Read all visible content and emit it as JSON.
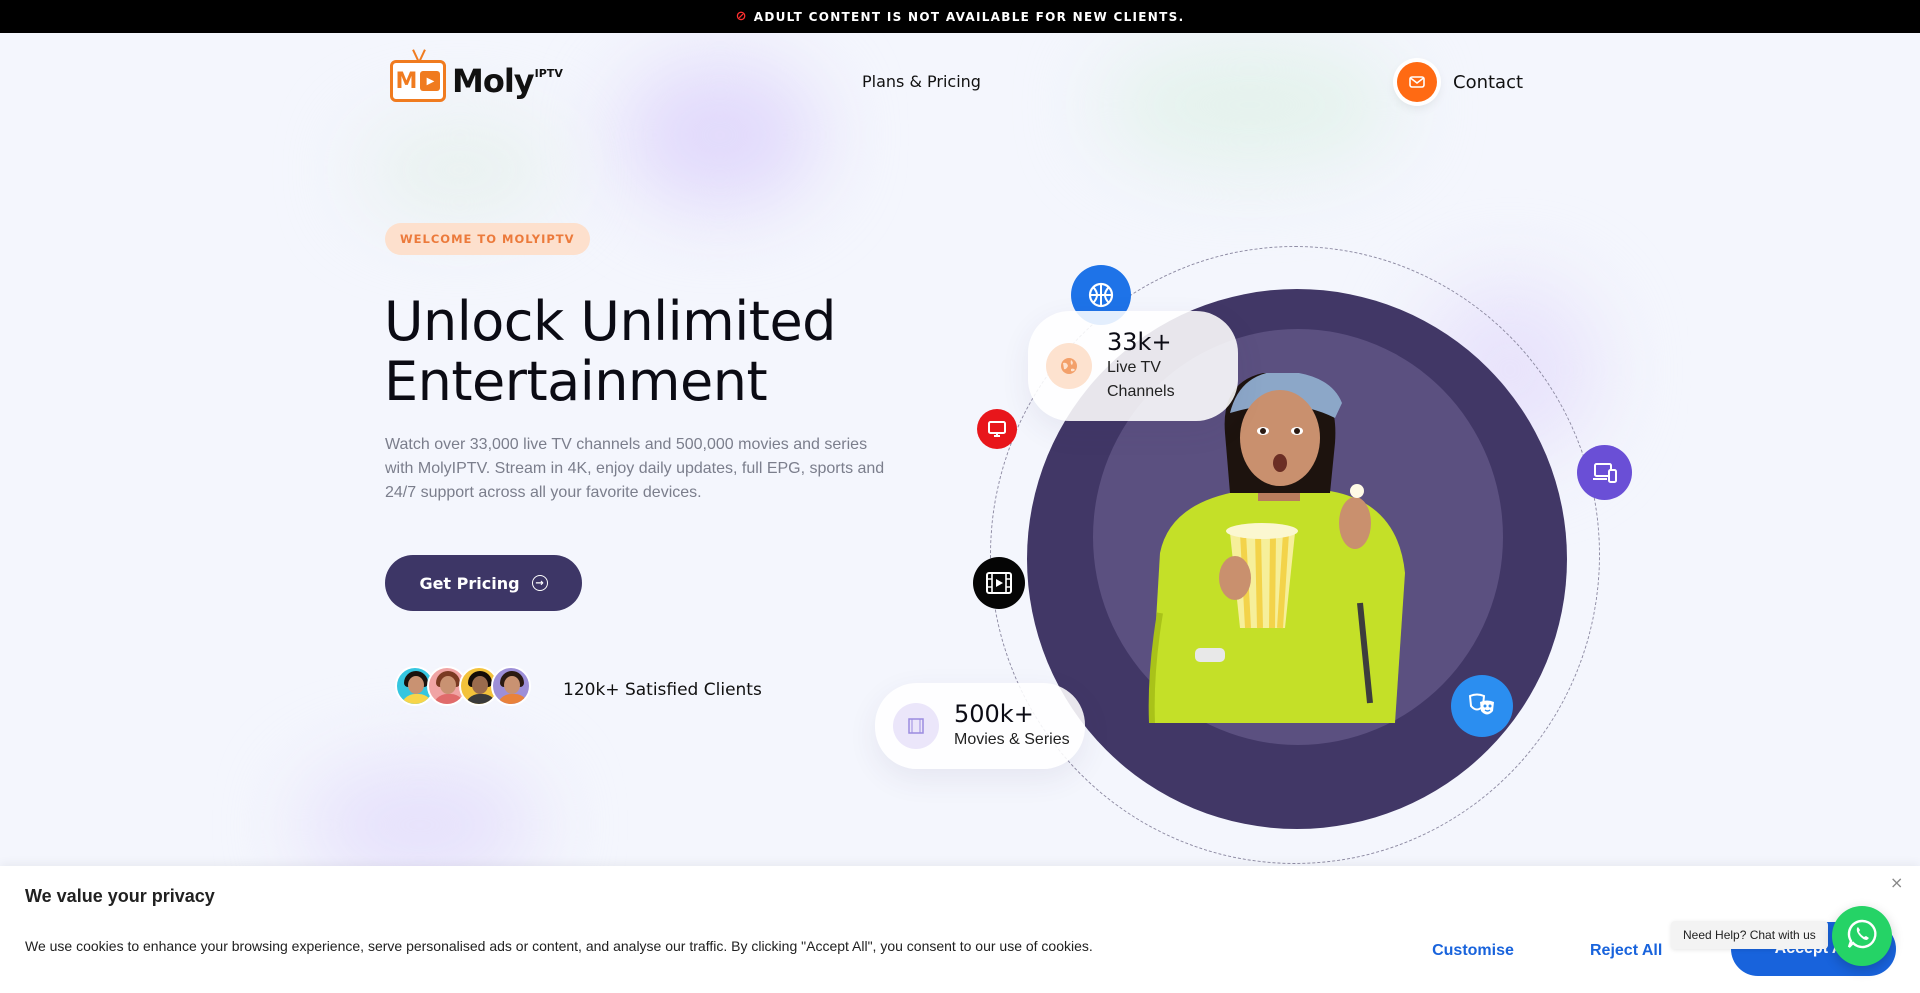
{
  "announcement": {
    "icon": "ban-icon",
    "text": "ADULT CONTENT IS NOT AVAILABLE FOR NEW CLIENTS."
  },
  "header": {
    "logo_text": "Moly",
    "logo_sup": "IPTV",
    "logo_letter": "M",
    "nav": {
      "plans": "Plans & Pricing"
    },
    "contact": {
      "label": "Contact",
      "icon": "mail-icon",
      "color": "#ff6a13"
    }
  },
  "hero": {
    "badge": "WELCOME TO MOLYIPTV",
    "title_line1": "Unlock Unlimited",
    "title_line2": "Entertainment",
    "description": "Watch over 33,000 live TV channels and 500,000 movies and series with MolyIPTV. Stream in 4K, enjoy daily updates, full EPG, sports and 24/7 support across all your favorite devices.",
    "cta_label": "Get Pricing",
    "clients_text": "120k+ Satisfied Clients",
    "accent_color": "#3d3666"
  },
  "stats": {
    "channels": {
      "value": "33k+",
      "label_line1": "Live TV",
      "label_line2": "Channels",
      "icon": "globe-icon"
    },
    "movies": {
      "value": "500k+",
      "label": "Movies & Series",
      "icon": "film-frame-icon"
    }
  },
  "orbit_icons": [
    "basketball-icon",
    "tv-icon",
    "film-icon",
    "devices-icon",
    "theater-masks-icon"
  ],
  "cookie": {
    "title": "We value your privacy",
    "text": "We use cookies to enhance your browsing experience, serve personalised ads or content, and analyse our traffic. By clicking \"Accept All\", you consent to our use of cookies.",
    "customise": "Customise",
    "reject": "Reject All",
    "accept": "Accept All",
    "close": "×",
    "button_color": "#1863dc"
  },
  "whatsapp": {
    "tooltip": "Need Help? Chat with us",
    "icon": "whatsapp-icon",
    "color": "#25d366"
  }
}
